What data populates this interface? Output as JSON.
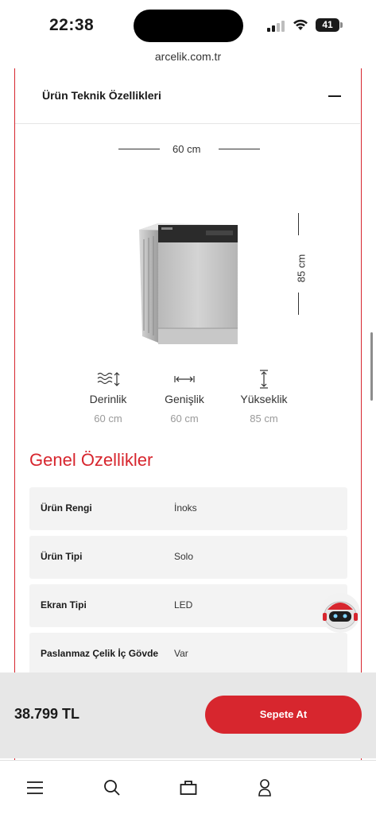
{
  "status_bar": {
    "time": "22:38",
    "battery": "41",
    "icons": [
      "signal-icon",
      "wifi-icon",
      "battery-icon"
    ]
  },
  "browser": {
    "url": "arcelik.com.tr"
  },
  "section": {
    "title": "Ürün Teknik Özellikleri",
    "collapse_icon": "minus-icon"
  },
  "dimensions_drawing": {
    "width_label": "60 cm",
    "height_label": "85 cm"
  },
  "dimensions": [
    {
      "icon": "depth-icon",
      "label": "Derinlik",
      "value": "60 cm"
    },
    {
      "icon": "width-icon",
      "label": "Genişlik",
      "value": "60 cm"
    },
    {
      "icon": "height-icon",
      "label": "Yükseklik",
      "value": "85 cm"
    }
  ],
  "general": {
    "title": "Genel Özellikler",
    "rows": [
      {
        "name": "Ürün Rengi",
        "value": "İnoks"
      },
      {
        "name": "Ürün Tipi",
        "value": "Solo"
      },
      {
        "name": "Ekran Tipi",
        "value": "LED"
      },
      {
        "name": "Paslanmaz Çelik İç Gövde",
        "value": "Var"
      }
    ]
  },
  "cart": {
    "price": "38.799 TL",
    "button_label": "Sepete At"
  },
  "tab_bar": {
    "items": [
      "menu-icon",
      "search-icon",
      "bag-icon",
      "user-icon"
    ]
  },
  "colors": {
    "brand_red": "#d7262e",
    "row_bg": "#f3f3f3",
    "cart_bar_bg": "#e7e7e7"
  }
}
